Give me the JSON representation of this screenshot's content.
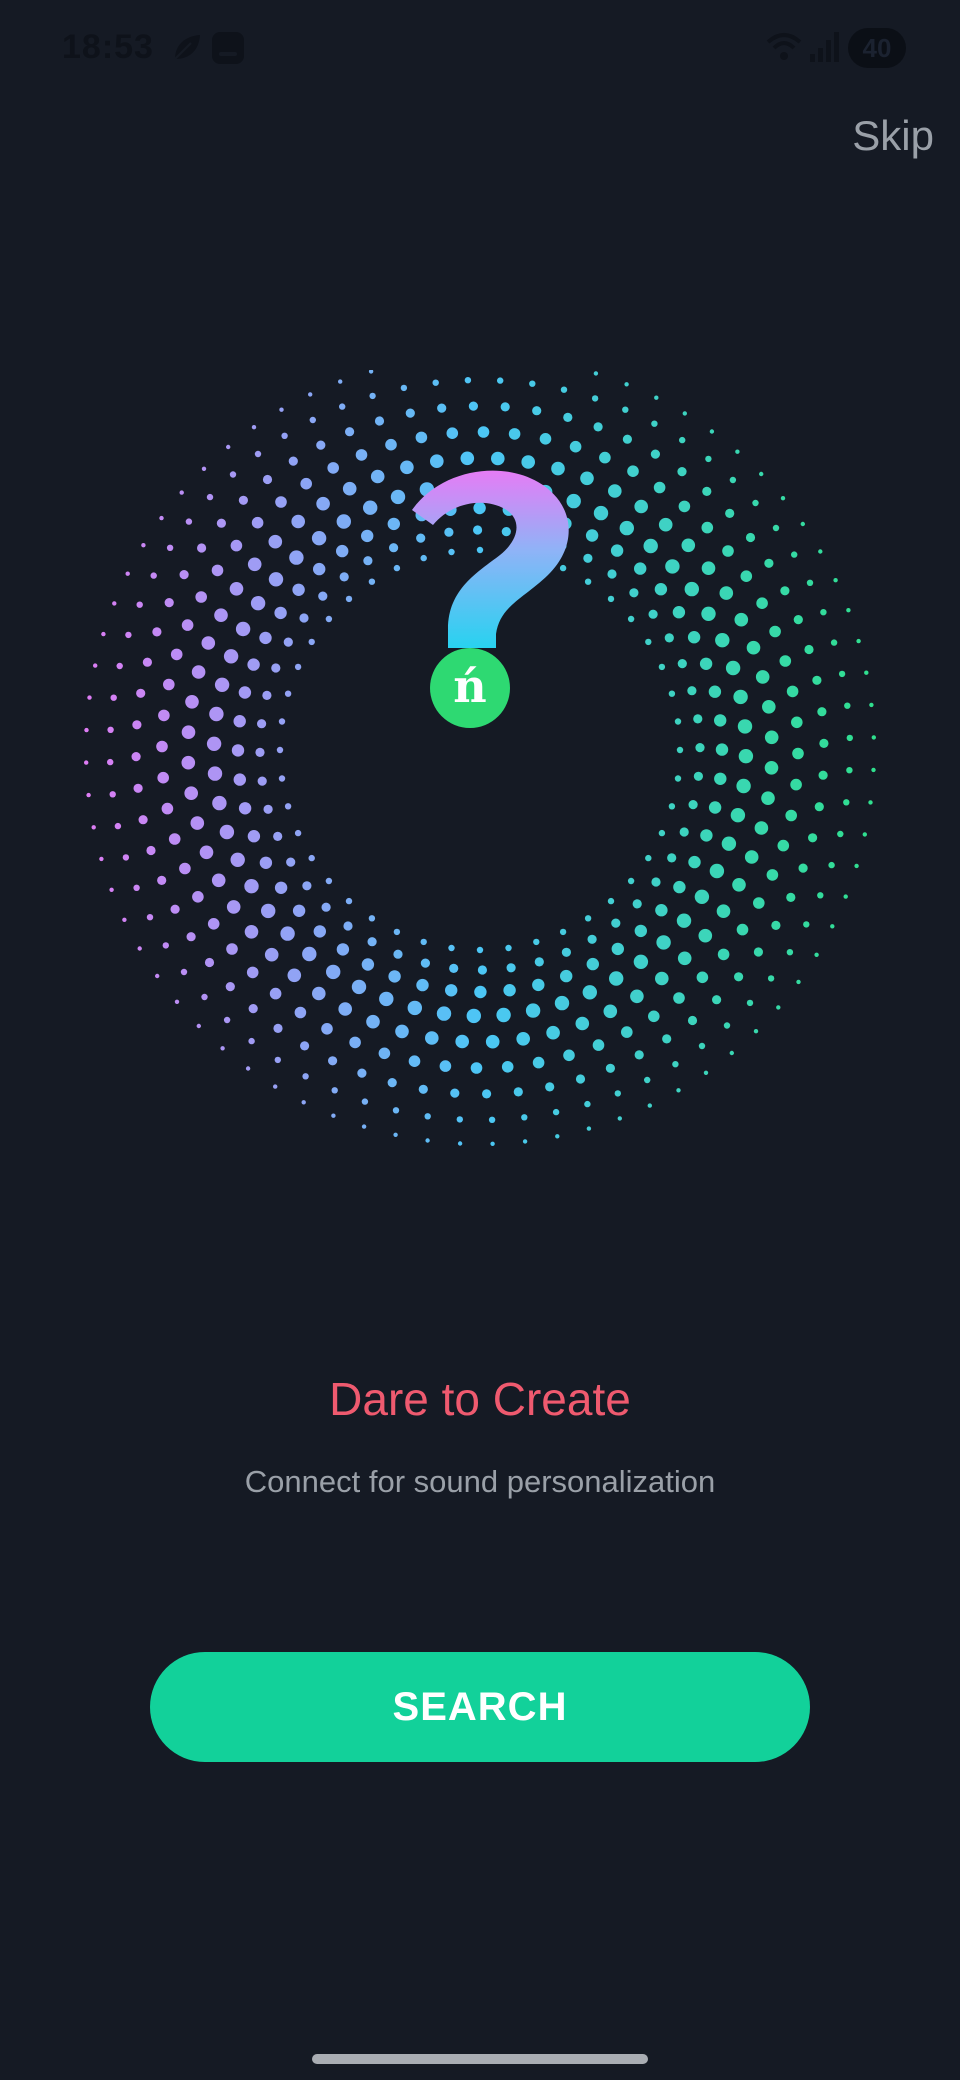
{
  "status_bar": {
    "time": "18:53",
    "battery": "40",
    "icons": [
      "leaf-icon",
      "app-notification-icon",
      "wifi-icon",
      "signal-icon",
      "battery-icon"
    ]
  },
  "header": {
    "skip_label": "Skip"
  },
  "hero": {
    "icon": "question-mark-icon",
    "badge_icon": "brand-logo-icon"
  },
  "content": {
    "title": "Dare to Create",
    "subtitle": "Connect for sound personalization"
  },
  "actions": {
    "search_label": "SEARCH"
  },
  "colors": {
    "background": "#151a24",
    "title": "#ef5a6f",
    "button": "#12d19a",
    "dot_pink": "#e07bf4",
    "dot_blue": "#4cc6f5",
    "dot_green": "#2fe08c"
  }
}
